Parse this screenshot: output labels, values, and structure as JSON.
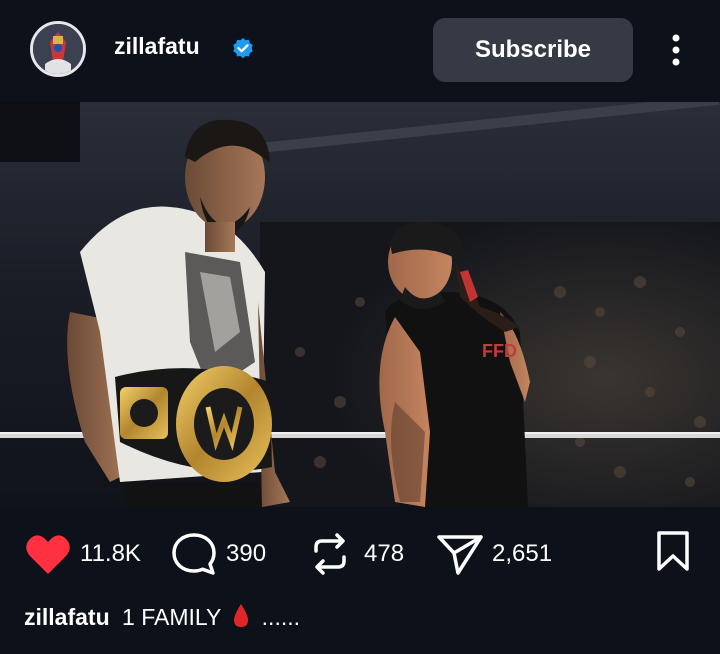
{
  "header": {
    "username": "zillafatu",
    "subscribe_label": "Subscribe",
    "verified_icon": "verified-badge-icon",
    "more_icon": "more-vertical-icon"
  },
  "post": {
    "image_alt": "Two wrestlers in a ring; one in a white t-shirt holding a championship belt, the other in a black tank top"
  },
  "actions": {
    "likes": "11.8K",
    "comments": "390",
    "reposts": "478",
    "shares": "2,651"
  },
  "caption": {
    "username": "zillafatu",
    "text": "1 FAMILY",
    "trailing": "......"
  },
  "colors": {
    "background": "#0c111a",
    "like_red": "#ff3040",
    "verified_blue": "#1d9bf0",
    "button_gray": "#353a44"
  }
}
